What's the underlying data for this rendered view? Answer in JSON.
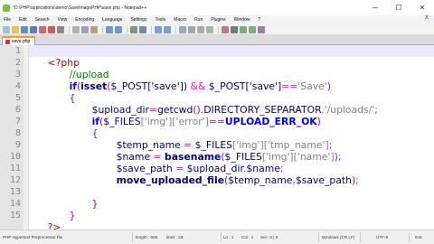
{
  "window": {
    "title": "*D:\\PHP\\applications\\demo\\SaveImagePHP\\save.php - Notepad++",
    "min_glyph": "─",
    "max_glyph": "☐",
    "close_glyph": "✕"
  },
  "menu": {
    "items": [
      "File",
      "Edit",
      "Search",
      "View",
      "Encoding",
      "Language",
      "Settings",
      "Tools",
      "Macro",
      "Run",
      "Plugins",
      "Window",
      "?"
    ],
    "close_glyph": "X"
  },
  "tab": {
    "label": "save.php"
  },
  "code": {
    "line_numbers": [
      "1",
      "2",
      "3",
      "4",
      "5",
      "6",
      "7",
      "8",
      "9",
      "10",
      "11",
      "12",
      "13",
      "14",
      "15"
    ],
    "line1": {
      "open": "<?php"
    },
    "line2": {
      "comment": "//upload"
    },
    "line3": {
      "kw": "if",
      "p1": "(",
      "func": "isset",
      "p2": "(",
      "var1": "$_POST",
      "br1": "['",
      "s1": "save",
      "br2": "'])",
      "amp": " && ",
      "var2": "$_POST",
      "br3": "['",
      "s2": "save",
      "br4": "']",
      "eq": "==",
      "s3": "'Save'",
      "p3": ")"
    },
    "line4": {
      "brace": "{"
    },
    "line5": {
      "var": "$upload_dir",
      "eq": "=",
      "func": "getcwd",
      "par": "()",
      "dot": ".",
      "const": "DIRECTORY_SEPARATOR",
      "dot2": ".",
      "str": "'/uploads/'",
      "semi": ";"
    },
    "line6": {
      "kw": "if",
      "p1": "(",
      "var": "$_FILES",
      "s1": "['img']['error']",
      "eq": "==",
      "const": "UPLOAD_ERR_OK",
      "p2": ")"
    },
    "line7": {
      "brace": "{"
    },
    "line8": {
      "var": "$temp_name",
      "eq": " = ",
      "var2": "$_FILES",
      "s1": "['img']['tmp_name']",
      "semi": ";"
    },
    "line9": {
      "var": "$name",
      "eq": " = ",
      "func": "basename",
      "p1": "(",
      "var2": "$_FILES",
      "s1": "['img']['name']",
      "p2": ")",
      "semi": ";"
    },
    "line10": {
      "var": "$save_path",
      "eq": " = ",
      "var2": "$upload_dir",
      "dot": ".",
      "var3": "$name",
      "semi": ";"
    },
    "line11": {
      "func": "move_uploaded_file",
      "p1": "(",
      "var": "$temp_name",
      "comma": ",",
      "var2": "$save_path",
      "p2": ")",
      "semi": ";"
    },
    "line12": {
      "text": ""
    },
    "line13": {
      "brace": "}"
    },
    "line14": {
      "brace": "}"
    },
    "line15": {
      "close": "?>"
    }
  },
  "status": {
    "type": "PHP Hypertext Preprocessor file",
    "length": "length : 608",
    "lines": "lines : 26",
    "ln": "Ln : 1",
    "col": "Col : 1",
    "sel": "Sel : 0 | 0",
    "eol": "Windows (CR LF)",
    "encoding": "UTF-8",
    "mode": "INS"
  },
  "colors": {
    "tab_accent": "#f29c33",
    "tag": "#c00000",
    "comment": "#008000",
    "keyword": "#0000ff",
    "current_line": "#e8e8ff"
  }
}
